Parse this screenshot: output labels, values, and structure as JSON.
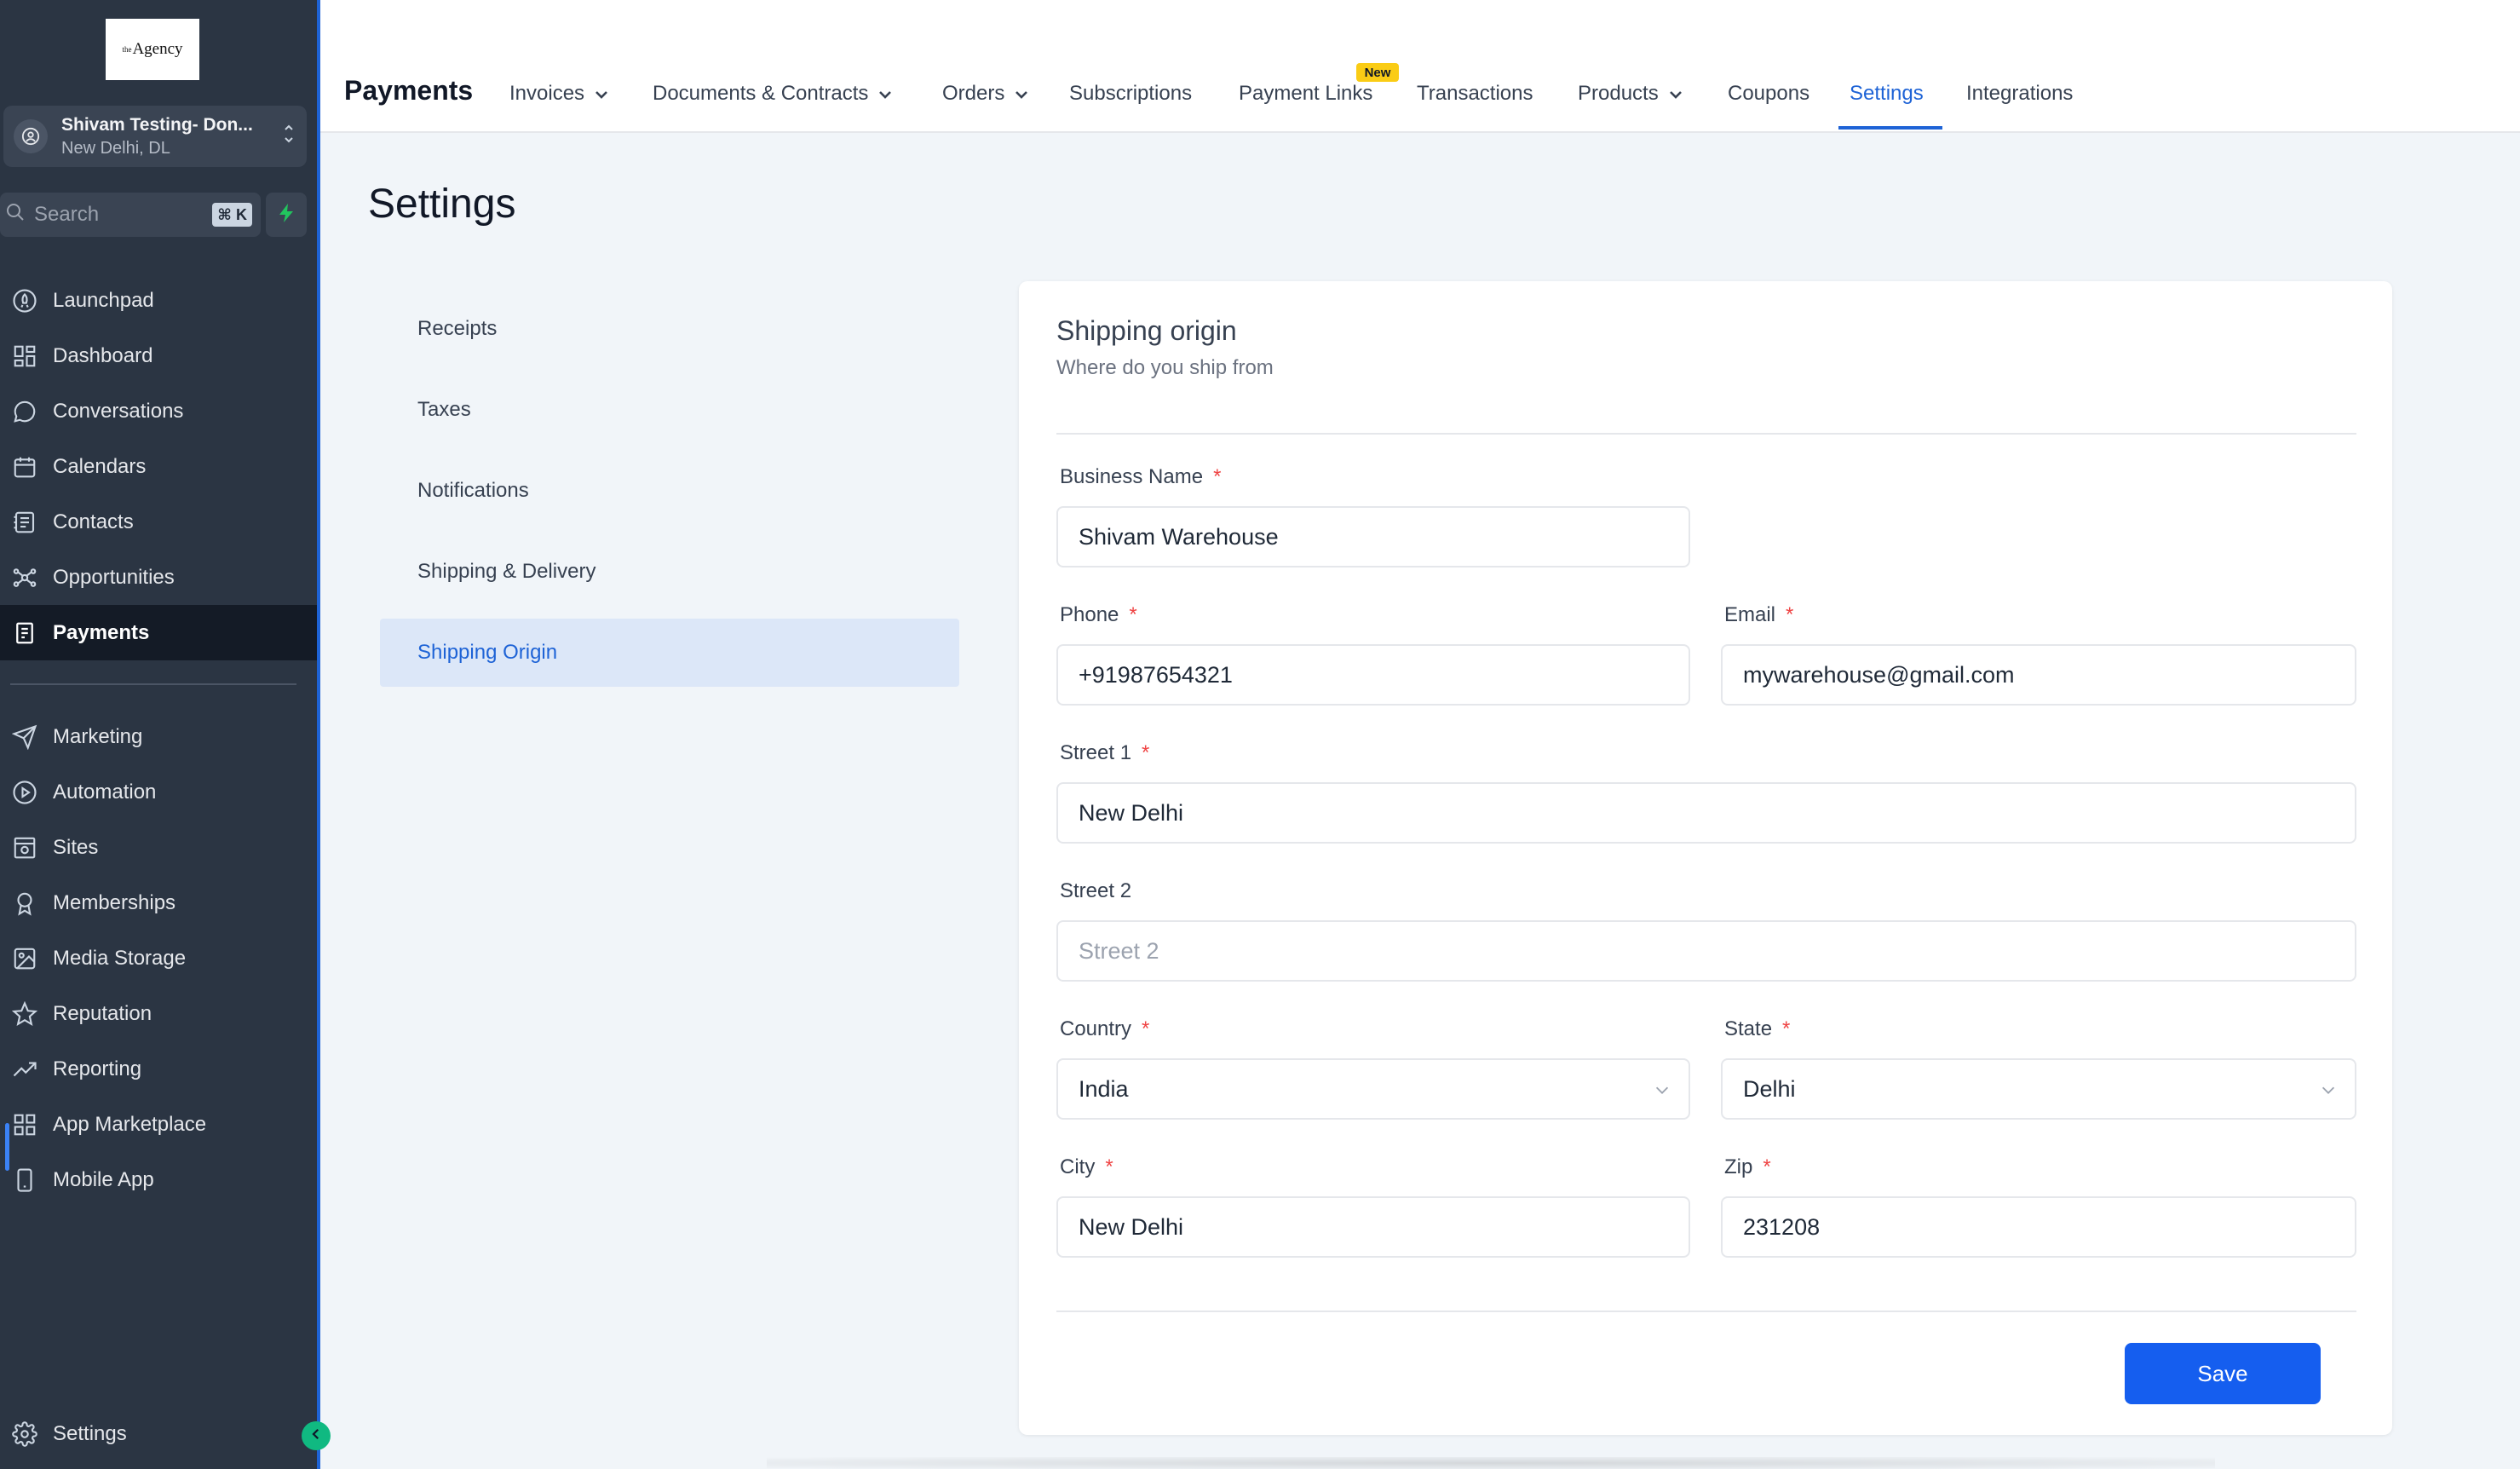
{
  "sidebar": {
    "logo": "Agency",
    "logo_prefix": "the",
    "location": {
      "name": "Shivam Testing- Don...",
      "city": "New Delhi, DL"
    },
    "search": {
      "placeholder": "Search",
      "shortcut": "⌘ K"
    },
    "items": [
      {
        "label": "Launchpad",
        "icon": "rocket-icon"
      },
      {
        "label": "Dashboard",
        "icon": "dashboard-icon"
      },
      {
        "label": "Conversations",
        "icon": "chat-icon"
      },
      {
        "label": "Calendars",
        "icon": "calendar-icon"
      },
      {
        "label": "Contacts",
        "icon": "contacts-icon"
      },
      {
        "label": "Opportunities",
        "icon": "opportunities-icon"
      },
      {
        "label": "Payments",
        "icon": "payments-icon",
        "active": true
      }
    ],
    "items2": [
      {
        "label": "Marketing",
        "icon": "send-icon"
      },
      {
        "label": "Automation",
        "icon": "automation-icon"
      },
      {
        "label": "Sites",
        "icon": "sites-icon"
      },
      {
        "label": "Memberships",
        "icon": "badge-icon"
      },
      {
        "label": "Media Storage",
        "icon": "image-icon"
      },
      {
        "label": "Reputation",
        "icon": "star-icon"
      },
      {
        "label": "Reporting",
        "icon": "trend-icon"
      },
      {
        "label": "App Marketplace",
        "icon": "grid-icon"
      },
      {
        "label": "Mobile App",
        "icon": "phone-icon"
      }
    ],
    "settings_label": "Settings"
  },
  "header": {
    "title": "Payments",
    "tabs": [
      {
        "label": "Invoices",
        "dropdown": true
      },
      {
        "label": "Documents & Contracts",
        "dropdown": true
      },
      {
        "label": "Orders",
        "dropdown": true
      },
      {
        "label": "Subscriptions",
        "dropdown": false
      },
      {
        "label": "Payment Links",
        "dropdown": false,
        "badge": "New"
      },
      {
        "label": "Transactions",
        "dropdown": false
      },
      {
        "label": "Products",
        "dropdown": true
      },
      {
        "label": "Coupons",
        "dropdown": false
      },
      {
        "label": "Settings",
        "dropdown": false,
        "active": true
      },
      {
        "label": "Integrations",
        "dropdown": false
      }
    ]
  },
  "page": {
    "title": "Settings",
    "settings_nav": [
      "Receipts",
      "Taxes",
      "Notifications",
      "Shipping & Delivery",
      "Shipping Origin"
    ],
    "active_settings_nav": "Shipping Origin"
  },
  "form": {
    "title": "Shipping origin",
    "subtitle": "Where do you ship from",
    "business_name": {
      "label": "Business Name",
      "value": "Shivam Warehouse"
    },
    "phone": {
      "label": "Phone",
      "value": "+91987654321"
    },
    "email": {
      "label": "Email",
      "value": "mywarehouse@gmail.com"
    },
    "street1": {
      "label": "Street 1",
      "value": "New Delhi"
    },
    "street2": {
      "label": "Street 2",
      "placeholder": "Street 2"
    },
    "country": {
      "label": "Country",
      "value": "India"
    },
    "state": {
      "label": "State",
      "value": "Delhi"
    },
    "city": {
      "label": "City",
      "value": "New Delhi"
    },
    "zip": {
      "label": "Zip",
      "value": "231208"
    },
    "required_mark": "*",
    "save_label": "Save"
  },
  "colors": {
    "sidebar_bg": "#2b3543",
    "accent": "#1e63d6",
    "save_button": "#155eef",
    "required": "#ef4444",
    "badge": "#facc15"
  }
}
